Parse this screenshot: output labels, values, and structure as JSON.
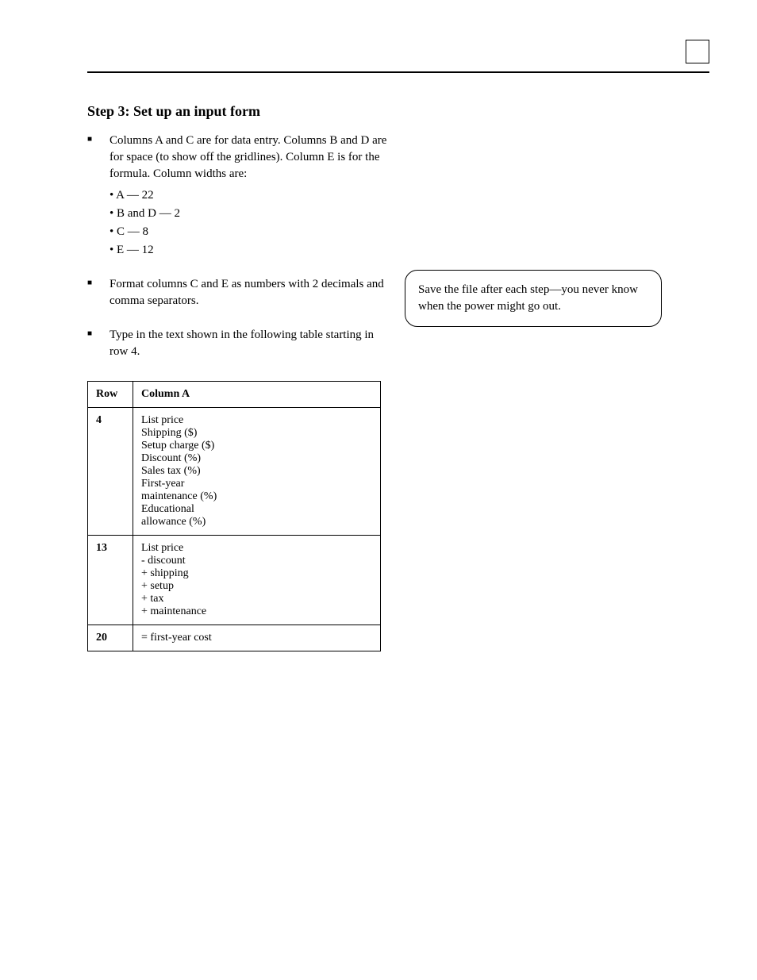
{
  "heading": "Step 3: Set up an input form",
  "bullets": [
    {
      "lead": "Columns A and C are for data entry. Columns B and D are for space (to show off the gridlines). Column E is for the formula. Column widths are:",
      "subs": [
        "• A — 22",
        "• B and D — 2",
        "• C — 8",
        "• E — 12"
      ]
    },
    {
      "lead": "Format columns C and E as numbers with 2 decimals and comma separators.",
      "subs": []
    },
    {
      "lead": "Type in the text shown in the following table starting in row 4.",
      "subs": []
    }
  ],
  "callout": "Save the file after each step—you never know when the power might go out.",
  "table": {
    "headers": [
      "Row",
      "Column A"
    ],
    "rows": [
      {
        "num": "4",
        "text": "List price\nShipping ($)\nSetup charge ($)\nDiscount (%)\nSales tax (%)\nFirst-year\nmaintenance (%)\nEducational\nallowance (%)"
      },
      {
        "num": "13",
        "text": "List price\n- discount\n+ shipping\n+ setup\n+ tax\n+ maintenance"
      },
      {
        "num": "20",
        "text": "= first-year cost"
      }
    ]
  }
}
